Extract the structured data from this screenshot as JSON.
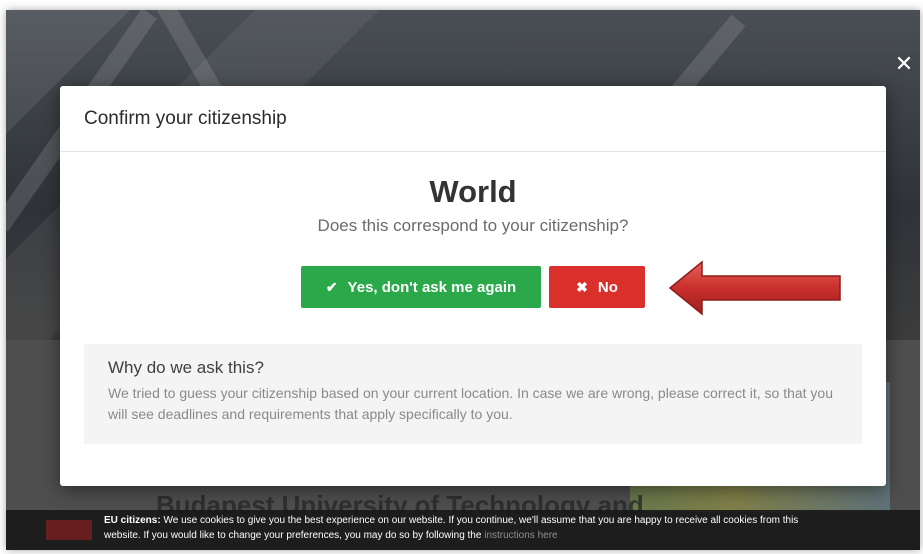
{
  "modal": {
    "title": "Confirm your citizenship",
    "country": "World",
    "question": "Does this correspond to your citizenship?",
    "yes_label": "Yes, don't ask me again",
    "no_label": "No",
    "why_title": "Why do we ask this?",
    "why_text": "We tried to guess your citizenship based on your current location. In case we are wrong, please correct it, so that you will see deadlines and requirements that apply specifically to you."
  },
  "background": {
    "university_title": "Budapest University of Technology and"
  },
  "cookie_bar": {
    "label": "EU citizens:",
    "text_line1": " We use cookies to give you the best experience on our website. If you continue, we'll assume that you are happy to receive all cookies from this",
    "text_line2": "website. If you would like to change your preferences, you may do so by following the ",
    "link_text": "instructions here"
  },
  "icons": {
    "check": "check-icon",
    "times": "times-icon",
    "close": "close-icon"
  },
  "colors": {
    "yes_button": "#2aa84a",
    "no_button": "#d9302c",
    "arrow": "#c9302c"
  }
}
